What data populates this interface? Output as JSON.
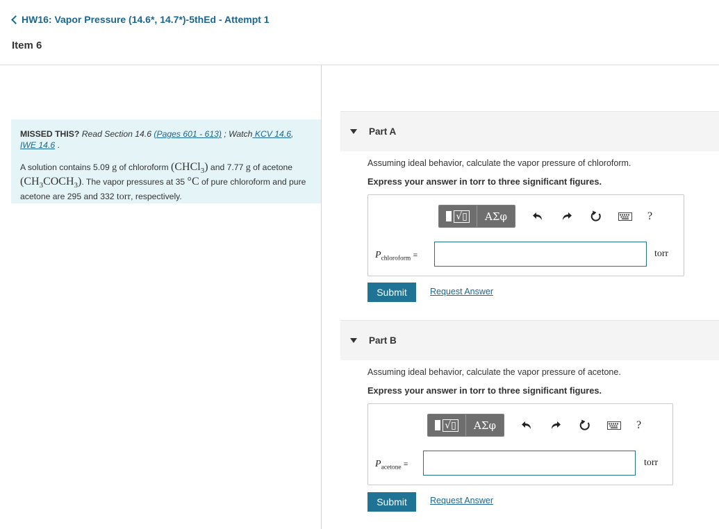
{
  "header": {
    "back_link": "HW16: Vapor Pressure (14.6*, 14.7*)-5thEd - Attempt 1",
    "item": "Item 6"
  },
  "missed": {
    "lead": "MISSED THIS?",
    "read": " Read Section 14.6 ",
    "pages_link": "(Pages 601 - 613)",
    "watch": " ; Watch",
    "kcv_link": " KCV 14.6",
    "sep": ", ",
    "iwe_link": "IWE 14.6",
    "end": " .",
    "problem": {
      "t1": "A solution contains 5.09 ",
      "g1": "g",
      "t2": " of chloroform ",
      "f1": "(CHCl",
      "f1sub": "3",
      "f1end": ")",
      "t3": " and 7.77 ",
      "g2": "g",
      "t4": " of acetone ",
      "f2a": "(CH",
      "f2asub": "3",
      "f2b": "COCH",
      "f2bsub": "3",
      "f2end": ")",
      "t5": ". The vapor pressures at 35 ",
      "deg": "°C",
      "t6": " of pure chloroform and pure acetone are 295 and 332 ",
      "torr": "torr",
      "t7": ", respectively."
    }
  },
  "parts": [
    {
      "title": "Part A",
      "question": "Assuming ideal behavior, calculate the vapor pressure of chloroform.",
      "instruction": "Express your answer in torr to three significant figures.",
      "var": "P",
      "var_sub": "chloroform",
      "equals": "=",
      "value": "",
      "unit": "torr",
      "submit": "Submit",
      "request": "Request Answer"
    },
    {
      "title": "Part B",
      "question": "Assuming ideal behavior, calculate the vapor pressure of acetone.",
      "instruction": "Express your answer in torr to three significant figures.",
      "var": "P",
      "var_sub": "acetone",
      "equals": "=",
      "value": "",
      "unit": "torr",
      "submit": "Submit",
      "request": "Request Answer"
    }
  ],
  "toolbar": {
    "templates_icon": "templates-icon",
    "templates_glyph": "√□",
    "greek_label": "ΑΣφ",
    "undo_icon": "undo-icon",
    "redo_icon": "redo-icon",
    "reset_icon": "reset-icon",
    "keyboard_icon": "keyboard-icon",
    "help_label": "?"
  },
  "colors": {
    "link": "#1a6690",
    "submit_bg": "#1f7496",
    "missed_bg": "#e5f4f6",
    "toolbar_bg": "#6e6e6e"
  }
}
